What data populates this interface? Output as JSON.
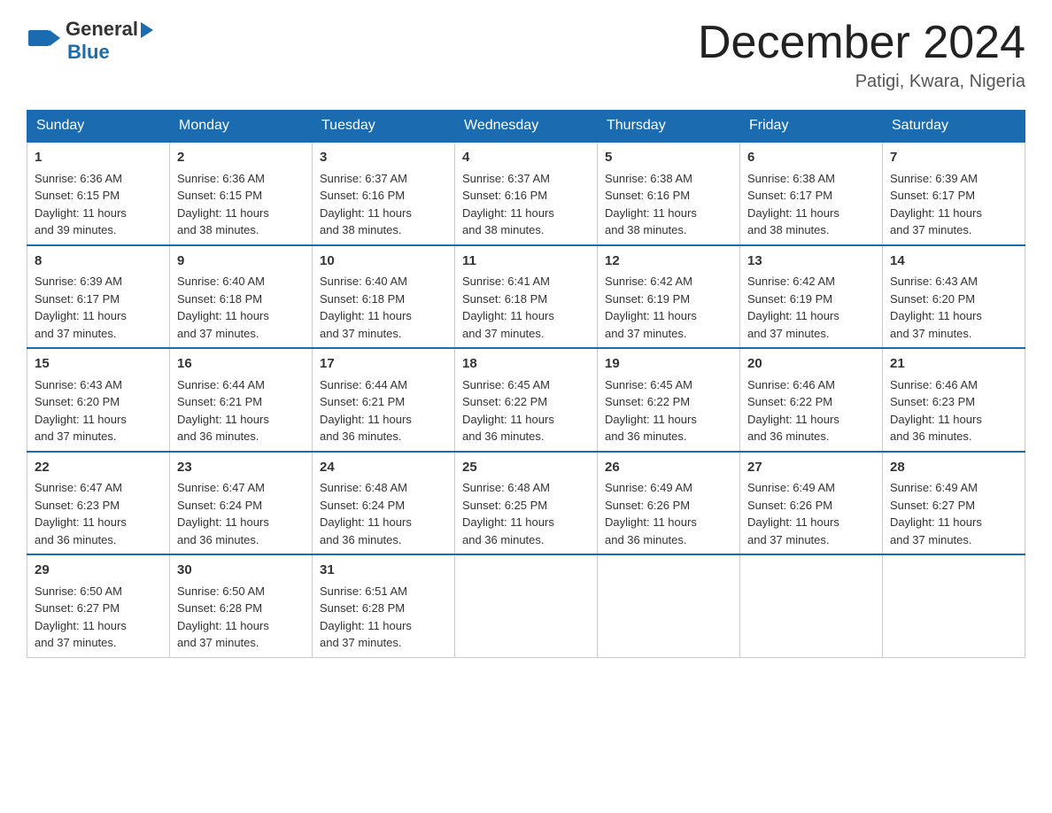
{
  "header": {
    "logo": {
      "general": "General",
      "blue": "Blue"
    },
    "title": "December 2024",
    "location": "Patigi, Kwara, Nigeria"
  },
  "calendar": {
    "days": [
      "Sunday",
      "Monday",
      "Tuesday",
      "Wednesday",
      "Thursday",
      "Friday",
      "Saturday"
    ],
    "weeks": [
      [
        {
          "num": "1",
          "sunrise": "6:36 AM",
          "sunset": "6:15 PM",
          "daylight": "11 hours and 39 minutes."
        },
        {
          "num": "2",
          "sunrise": "6:36 AM",
          "sunset": "6:15 PM",
          "daylight": "11 hours and 38 minutes."
        },
        {
          "num": "3",
          "sunrise": "6:37 AM",
          "sunset": "6:16 PM",
          "daylight": "11 hours and 38 minutes."
        },
        {
          "num": "4",
          "sunrise": "6:37 AM",
          "sunset": "6:16 PM",
          "daylight": "11 hours and 38 minutes."
        },
        {
          "num": "5",
          "sunrise": "6:38 AM",
          "sunset": "6:16 PM",
          "daylight": "11 hours and 38 minutes."
        },
        {
          "num": "6",
          "sunrise": "6:38 AM",
          "sunset": "6:17 PM",
          "daylight": "11 hours and 38 minutes."
        },
        {
          "num": "7",
          "sunrise": "6:39 AM",
          "sunset": "6:17 PM",
          "daylight": "11 hours and 37 minutes."
        }
      ],
      [
        {
          "num": "8",
          "sunrise": "6:39 AM",
          "sunset": "6:17 PM",
          "daylight": "11 hours and 37 minutes."
        },
        {
          "num": "9",
          "sunrise": "6:40 AM",
          "sunset": "6:18 PM",
          "daylight": "11 hours and 37 minutes."
        },
        {
          "num": "10",
          "sunrise": "6:40 AM",
          "sunset": "6:18 PM",
          "daylight": "11 hours and 37 minutes."
        },
        {
          "num": "11",
          "sunrise": "6:41 AM",
          "sunset": "6:18 PM",
          "daylight": "11 hours and 37 minutes."
        },
        {
          "num": "12",
          "sunrise": "6:42 AM",
          "sunset": "6:19 PM",
          "daylight": "11 hours and 37 minutes."
        },
        {
          "num": "13",
          "sunrise": "6:42 AM",
          "sunset": "6:19 PM",
          "daylight": "11 hours and 37 minutes."
        },
        {
          "num": "14",
          "sunrise": "6:43 AM",
          "sunset": "6:20 PM",
          "daylight": "11 hours and 37 minutes."
        }
      ],
      [
        {
          "num": "15",
          "sunrise": "6:43 AM",
          "sunset": "6:20 PM",
          "daylight": "11 hours and 37 minutes."
        },
        {
          "num": "16",
          "sunrise": "6:44 AM",
          "sunset": "6:21 PM",
          "daylight": "11 hours and 36 minutes."
        },
        {
          "num": "17",
          "sunrise": "6:44 AM",
          "sunset": "6:21 PM",
          "daylight": "11 hours and 36 minutes."
        },
        {
          "num": "18",
          "sunrise": "6:45 AM",
          "sunset": "6:22 PM",
          "daylight": "11 hours and 36 minutes."
        },
        {
          "num": "19",
          "sunrise": "6:45 AM",
          "sunset": "6:22 PM",
          "daylight": "11 hours and 36 minutes."
        },
        {
          "num": "20",
          "sunrise": "6:46 AM",
          "sunset": "6:22 PM",
          "daylight": "11 hours and 36 minutes."
        },
        {
          "num": "21",
          "sunrise": "6:46 AM",
          "sunset": "6:23 PM",
          "daylight": "11 hours and 36 minutes."
        }
      ],
      [
        {
          "num": "22",
          "sunrise": "6:47 AM",
          "sunset": "6:23 PM",
          "daylight": "11 hours and 36 minutes."
        },
        {
          "num": "23",
          "sunrise": "6:47 AM",
          "sunset": "6:24 PM",
          "daylight": "11 hours and 36 minutes."
        },
        {
          "num": "24",
          "sunrise": "6:48 AM",
          "sunset": "6:24 PM",
          "daylight": "11 hours and 36 minutes."
        },
        {
          "num": "25",
          "sunrise": "6:48 AM",
          "sunset": "6:25 PM",
          "daylight": "11 hours and 36 minutes."
        },
        {
          "num": "26",
          "sunrise": "6:49 AM",
          "sunset": "6:26 PM",
          "daylight": "11 hours and 36 minutes."
        },
        {
          "num": "27",
          "sunrise": "6:49 AM",
          "sunset": "6:26 PM",
          "daylight": "11 hours and 37 minutes."
        },
        {
          "num": "28",
          "sunrise": "6:49 AM",
          "sunset": "6:27 PM",
          "daylight": "11 hours and 37 minutes."
        }
      ],
      [
        {
          "num": "29",
          "sunrise": "6:50 AM",
          "sunset": "6:27 PM",
          "daylight": "11 hours and 37 minutes."
        },
        {
          "num": "30",
          "sunrise": "6:50 AM",
          "sunset": "6:28 PM",
          "daylight": "11 hours and 37 minutes."
        },
        {
          "num": "31",
          "sunrise": "6:51 AM",
          "sunset": "6:28 PM",
          "daylight": "11 hours and 37 minutes."
        },
        null,
        null,
        null,
        null
      ]
    ]
  }
}
